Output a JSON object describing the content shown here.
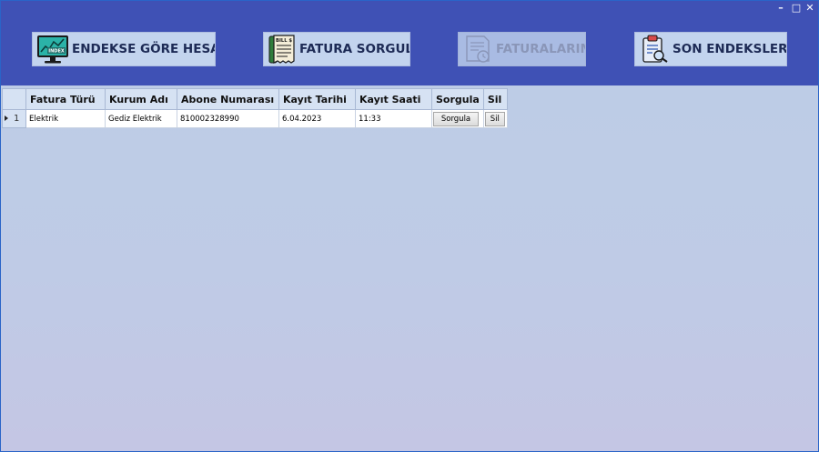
{
  "window": {
    "controls": {
      "minimize": "–",
      "maximize": "□",
      "close": "✕"
    }
  },
  "nav": {
    "endeks": {
      "label": "ENDEKSE GÖRE HESAPLA",
      "icon": "monitor-index-chart-icon",
      "icon_text": "INDEX"
    },
    "fatura_sorgula": {
      "label": "FATURA SORGULA",
      "icon": "bill-document-icon",
      "icon_text": "BILL $"
    },
    "faturalarim": {
      "label": "FATURALARIM",
      "icon": "invoice-clock-icon",
      "disabled": true
    },
    "son_endeksler": {
      "label": "SON ENDEKSLERİM",
      "icon": "clipboard-search-icon"
    }
  },
  "grid": {
    "columns": [
      "Fatura Türü",
      "Kurum Adı",
      "Abone Numarası",
      "Kayıt Tarihi",
      "Kayıt Saati",
      "Sorgula",
      "Sil"
    ],
    "rows": [
      {
        "index": "1",
        "fatura_turu": "Elektrik",
        "kurum_adi": "Gediz Elektrik",
        "abone_numarasi": "810002328990",
        "kayit_tarihi": "6.04.2023",
        "kayit_saati": "11:33",
        "sorgula_label": "Sorgula",
        "sil_label": "Sil"
      }
    ]
  },
  "colors": {
    "header_bg": "#3f51b5",
    "nav_button_bg": "#c3d4ee",
    "nav_button_disabled_bg": "#a9bbe3",
    "content_bg": "#bccde6",
    "grid_header_bg": "#d6e2f3"
  }
}
